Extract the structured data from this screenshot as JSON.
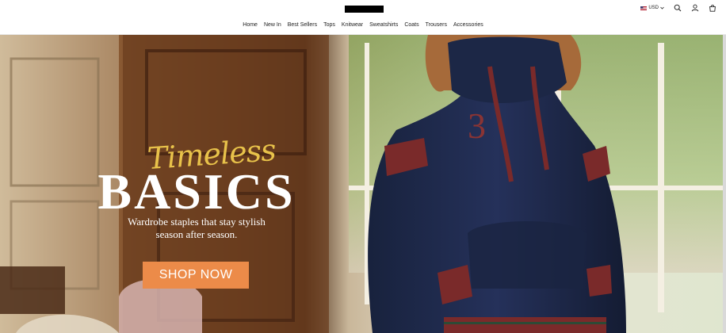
{
  "header": {
    "nav": [
      "Home",
      "New In",
      "Best Sellers",
      "Tops",
      "Knitwear",
      "Sweatshirts",
      "Coats",
      "Trousers",
      "Accessories"
    ],
    "currency": "USD",
    "icons": [
      "us-flag-icon",
      "chevron-down-icon",
      "search-icon",
      "account-icon",
      "bag-icon"
    ]
  },
  "hero": {
    "script_text": "Timeless",
    "title": "BASICS",
    "subtitle_line1": "Wardrobe staples that stay stylish",
    "subtitle_line2": "season after season.",
    "cta": "SHOP NOW"
  },
  "colors": {
    "accent": "#ec8b49",
    "script": "#e8c24a",
    "hoodie": "#1e2a48",
    "stripe": "#7a2a2a"
  }
}
